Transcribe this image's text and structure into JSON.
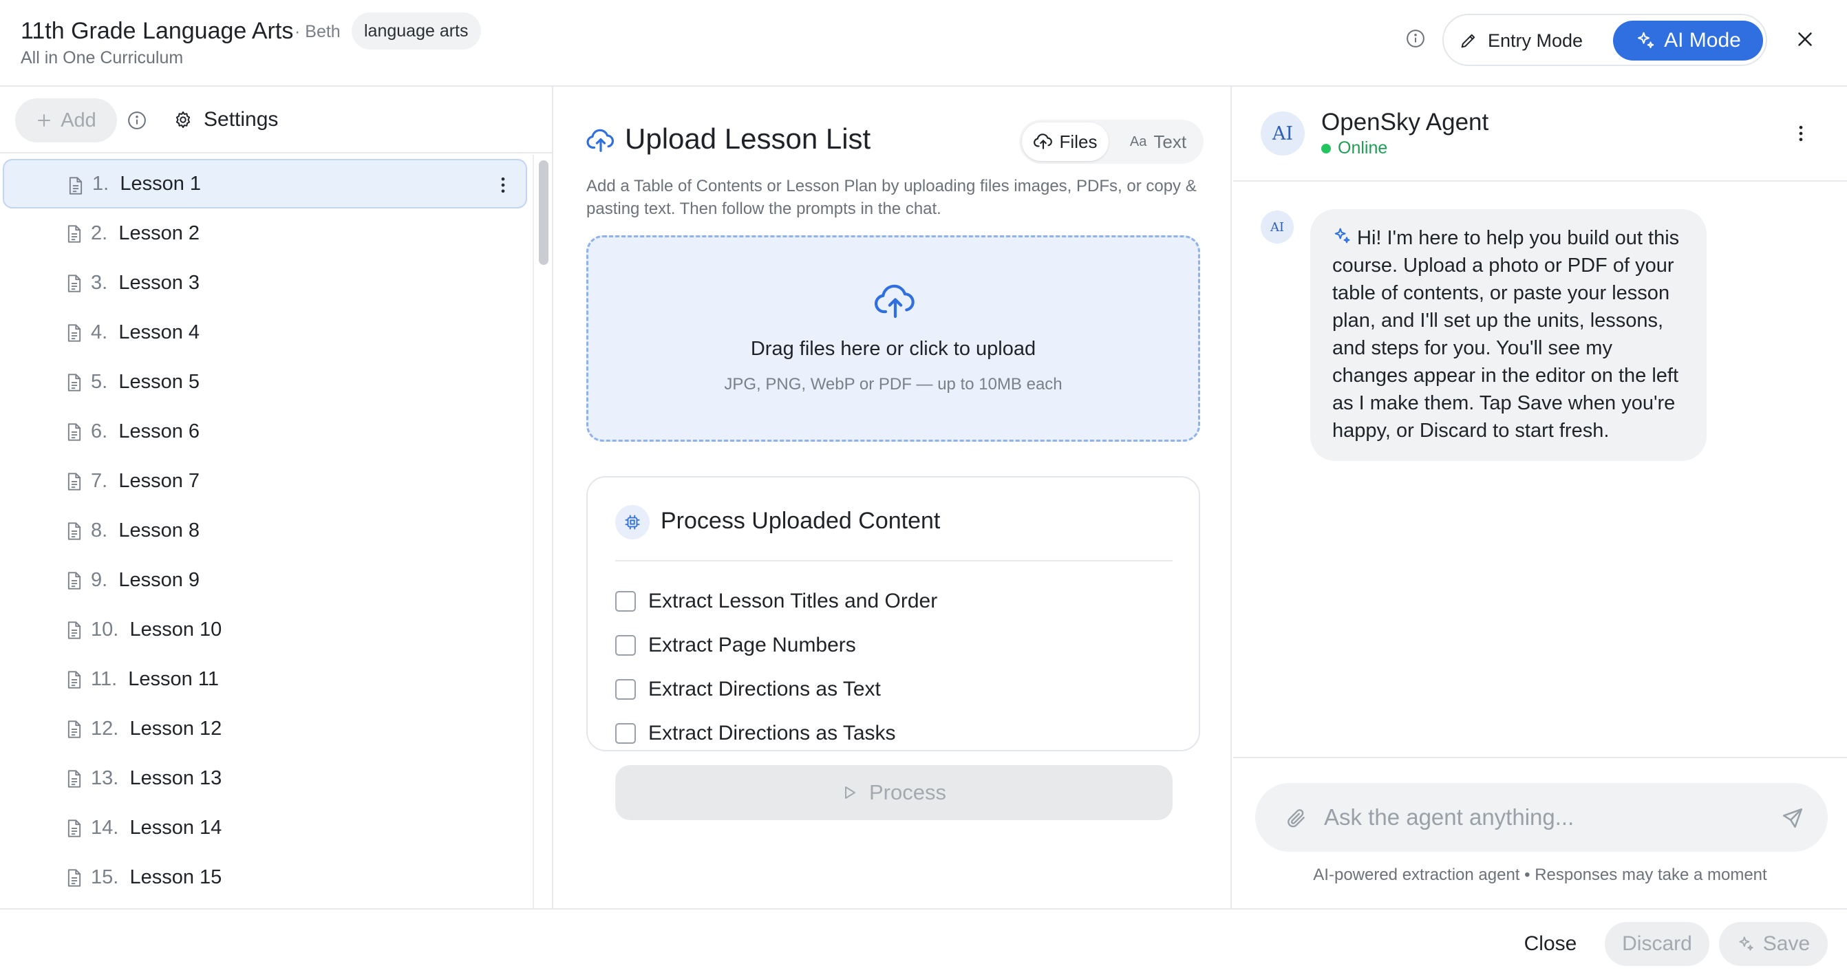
{
  "header": {
    "course_title": "11th Grade Language Arts",
    "owner": "· Beth",
    "subject_chip": "language arts",
    "subtitle": "All in One Curriculum",
    "entry_mode_label": "Entry Mode",
    "ai_mode_label": "AI Mode",
    "active_mode": "AI Mode",
    "info_icon": "info-icon",
    "close_icon": "close-icon"
  },
  "toolbar": {
    "add_label": "Add",
    "settings_label": "Settings"
  },
  "lessons": [
    {
      "number": "1.",
      "title": "Lesson 1",
      "selected": true
    },
    {
      "number": "2.",
      "title": "Lesson 2"
    },
    {
      "number": "3.",
      "title": "Lesson 3"
    },
    {
      "number": "4.",
      "title": "Lesson 4"
    },
    {
      "number": "5.",
      "title": "Lesson 5"
    },
    {
      "number": "6.",
      "title": "Lesson 6"
    },
    {
      "number": "7.",
      "title": "Lesson 7"
    },
    {
      "number": "8.",
      "title": "Lesson 8"
    },
    {
      "number": "9.",
      "title": "Lesson 9"
    },
    {
      "number": "10.",
      "title": "Lesson 10"
    },
    {
      "number": "11.",
      "title": "Lesson 11"
    },
    {
      "number": "12.",
      "title": "Lesson 12"
    },
    {
      "number": "13.",
      "title": "Lesson 13"
    },
    {
      "number": "14.",
      "title": "Lesson 14"
    },
    {
      "number": "15.",
      "title": "Lesson 15"
    }
  ],
  "upload": {
    "title": "Upload Lesson List",
    "files_tab": "Files",
    "text_tab": "Text",
    "text_tab_glyph": "Aa",
    "active_tab": "Files",
    "description": "Add a Table of Contents or Lesson Plan by uploading files images, PDFs, or copy & pasting text. Then follow the prompts in the chat.",
    "drop_main": "Drag files here or click to upload",
    "drop_sub": "JPG, PNG, WebP or PDF — up to 10MB each"
  },
  "process": {
    "title": "Process Uploaded Content",
    "options": [
      {
        "label": "Extract Lesson Titles and Order",
        "checked": false
      },
      {
        "label": "Extract Page Numbers",
        "checked": false
      },
      {
        "label": "Extract Directions as Text",
        "checked": false
      },
      {
        "label": "Extract Directions as Tasks",
        "checked": false
      }
    ],
    "button_label": "Process"
  },
  "agent": {
    "avatar": "AI",
    "name": "OpenSky Agent",
    "status": "Online",
    "message_avatar": "AI",
    "message": "Hi! I'm here to help you build out this course. Upload a photo or PDF of your table of contents, or paste your lesson plan, and I'll set up the units, lessons, and steps for you. You'll see my changes appear in the editor on the left as I make them. Tap Save when you're happy, or Discard to start fresh.",
    "input_placeholder": "Ask the agent anything...",
    "note": "AI-powered extraction agent • Responses may take a moment"
  },
  "footer": {
    "close_label": "Close",
    "discard_label": "Discard",
    "save_label": "Save"
  },
  "colors": {
    "accent": "#2f6fe0",
    "online": "#22c55e",
    "dropzone_bg": "#eaf1fd",
    "selected_row_bg": "#e8f0fc"
  }
}
